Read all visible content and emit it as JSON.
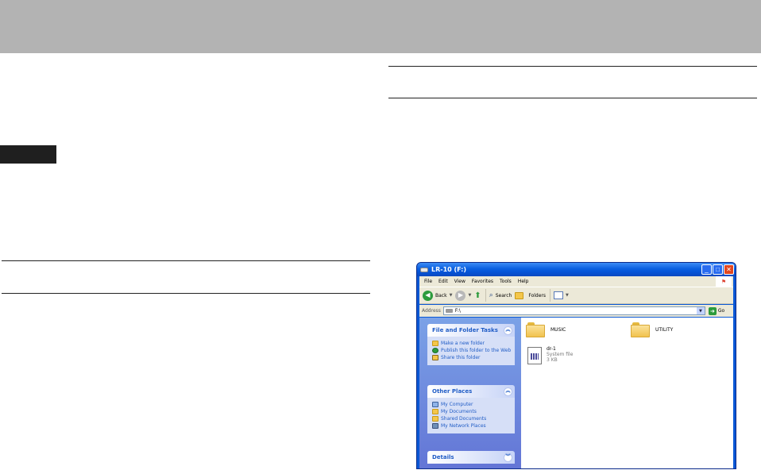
{
  "explorer": {
    "title": "LR-10 (F:)",
    "menu": [
      "File",
      "Edit",
      "View",
      "Favorites",
      "Tools",
      "Help"
    ],
    "toolbar": {
      "back": "Back",
      "search": "Search",
      "folders": "Folders"
    },
    "address": {
      "label": "Address",
      "value": "F:\\",
      "go": "Go"
    },
    "task_pane": {
      "file_folder_tasks": {
        "title": "File and Folder Tasks",
        "links": [
          "Make a new folder",
          "Publish this folder to the Web",
          "Share this folder"
        ]
      },
      "other_places": {
        "title": "Other Places",
        "links": [
          "My Computer",
          "My Documents",
          "Shared Documents",
          "My Network Places"
        ]
      },
      "details": {
        "title": "Details"
      }
    },
    "content": {
      "folders": [
        "MUSIC",
        "UTILITY"
      ],
      "file": {
        "name": "dr-1",
        "type": "System file",
        "size": "3 KB"
      }
    }
  }
}
